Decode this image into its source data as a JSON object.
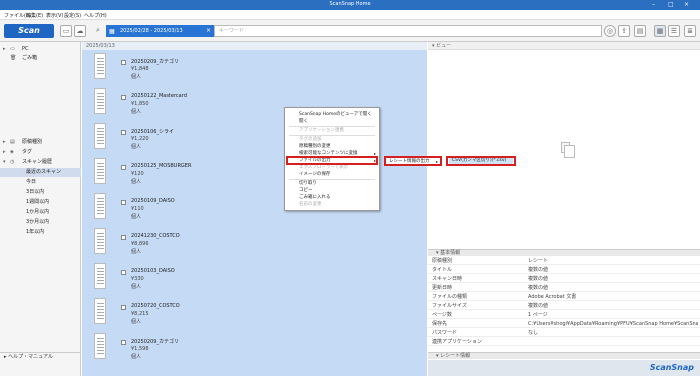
{
  "window": {
    "title": "ScanSnap Home"
  },
  "menu": [
    "ファイル(F)",
    "編集(E)",
    "表示(V)",
    "設定(S)",
    "ヘルプ(H)"
  ],
  "toolbar": {
    "scan_label": "Scan",
    "date_range": "2025/02/28 - 2025/03/13",
    "search_placeholder": "キーワード"
  },
  "sidebar": {
    "top_items": [
      {
        "label": "PC"
      },
      {
        "label": "ごみ箱"
      }
    ],
    "sections": [
      {
        "label": "原稿種別"
      },
      {
        "label": "タグ"
      },
      {
        "label": "スキャン履歴"
      }
    ],
    "history": [
      "最近のスキャン",
      "今日",
      "3日以内",
      "1週間以内",
      "1か月以内",
      "3か月以内",
      "1年以内"
    ],
    "help": "ヘルプ・マニュアル"
  },
  "list": {
    "header": "2025/03/13",
    "rows": [
      {
        "title": "20250209_カテゴリ",
        "amount": "¥1,848",
        "person": "個人"
      },
      {
        "title": "20250122_Mastercard",
        "amount": "¥1,850",
        "person": "個人"
      },
      {
        "title": "20250106_シライ",
        "amount": "¥1,220",
        "person": "個人"
      },
      {
        "title": "20250125_MOSBURGER",
        "amount": "¥120",
        "person": "個人"
      },
      {
        "title": "20250109_DAISO",
        "amount": "¥110",
        "person": "個人"
      },
      {
        "title": "20241230_COSTCO",
        "amount": "¥8,896",
        "person": "個人"
      },
      {
        "title": "20250103_DAISO",
        "amount": "¥330",
        "person": "個人"
      },
      {
        "title": "20250720_COSTCO",
        "amount": "¥8,215",
        "person": "個人"
      },
      {
        "title": "20250209_カテゴリ",
        "amount": "¥1,598",
        "person": "個人"
      }
    ]
  },
  "viewer": {
    "header": "ビュー"
  },
  "context_menu": {
    "items": [
      {
        "label": "ScanSnap Homeのビューアで開く",
        "disabled": false
      },
      {
        "label": "開く",
        "disabled": false
      },
      {
        "label": "アプリケーション連携",
        "disabled": true
      },
      {
        "label": "タグの追加",
        "disabled": true
      },
      {
        "label": "原稿種別の変更",
        "disabled": false
      },
      {
        "label": "検索可能なコンテンツに変換",
        "disabled": false
      },
      {
        "label": "ファイルの出力",
        "disabled": false
      },
      {
        "label": "エクスプローラーで表示",
        "disabled": true
      },
      {
        "label": "イメージの保存",
        "disabled": false
      },
      {
        "label": "切り取り",
        "disabled": false
      },
      {
        "label": "コピー",
        "disabled": false
      },
      {
        "label": "ごみ箱に入れる",
        "disabled": false
      },
      {
        "label": "名前の変更",
        "disabled": true
      }
    ],
    "submenu1": "レシート情報の出力",
    "submenu2": "CSV(カンマ区切り)(*.csv)"
  },
  "info": {
    "header": "基本情報",
    "rows": [
      {
        "key": "原稿種別",
        "value": "レシート"
      },
      {
        "key": "タイトル",
        "value": "複数の値"
      },
      {
        "key": "スキャン日時",
        "value": "複数の値"
      },
      {
        "key": "更新日時",
        "value": "複数の値"
      },
      {
        "key": "ファイルの種類",
        "value": "Adobe Acrobat 文書"
      },
      {
        "key": "ファイルサイズ",
        "value": "複数の値"
      },
      {
        "key": "ページ数",
        "value": "1 ページ"
      },
      {
        "key": "保存先",
        "value": "C:¥Users¥shogi¥AppData¥Roaming¥PFU¥ScanSnap Home¥ScanSnap Home¥レシート"
      },
      {
        "key": "パスワード",
        "value": "なし"
      },
      {
        "key": "連携アプリケーション",
        "value": ""
      }
    ],
    "header2": "レシート情報"
  },
  "brand": "ScanSnap",
  "colors": {
    "accent": "#2874d4",
    "list_bg": "#c5daf4",
    "highlight": "#d61f1f"
  }
}
